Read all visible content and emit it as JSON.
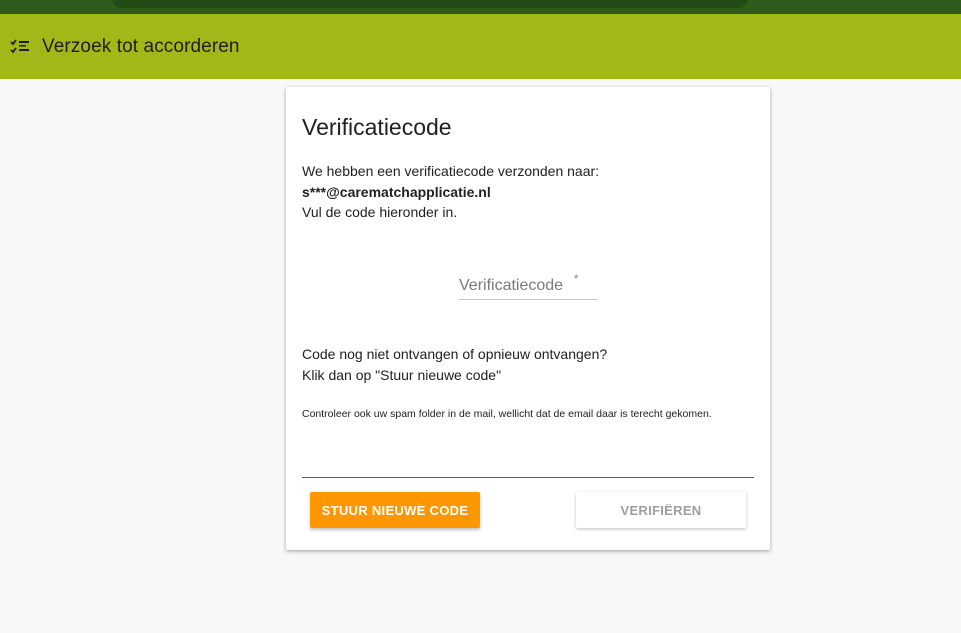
{
  "appbar": {
    "title": "Verzoek tot accorderen",
    "icon": "checklist-icon",
    "color": "#a2b818"
  },
  "card": {
    "title": "Verificatiecode",
    "intro_line1": "We hebben een verificatiecode verzonden naar:",
    "email": "s***@carematchapplicatie.nl",
    "intro_line3": "Vul de code hieronder in.",
    "code_field": {
      "placeholder": "Verificatiecode",
      "required_mark": "*",
      "value": ""
    },
    "info_line1": "Code nog niet ontvangen of opnieuw ontvangen?",
    "info_line2": "Klik dan op \"Stuur nieuwe code\"",
    "note": "Controleer ook uw spam folder in de mail, wellicht dat de email daar is terecht gekomen.",
    "resend_label": "Stuur nieuwe code",
    "verify_label": "Verifiëren"
  },
  "colors": {
    "accent": "#ff9800",
    "header_dark": "#2e5a1c"
  }
}
